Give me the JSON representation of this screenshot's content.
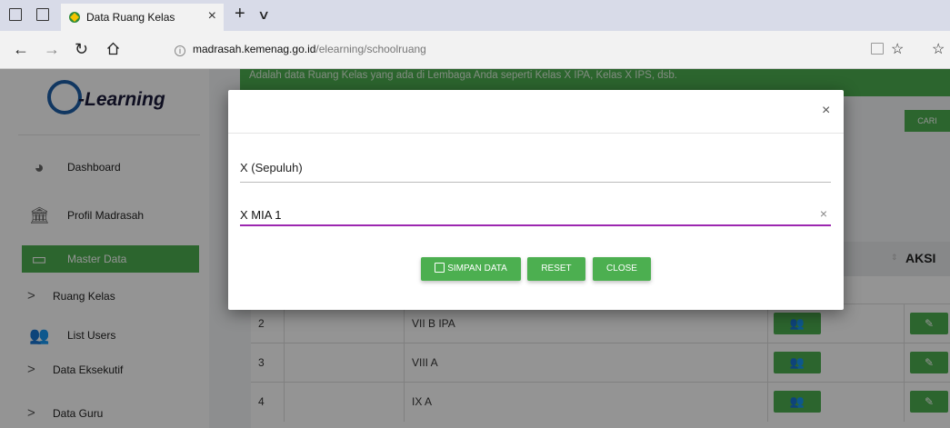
{
  "browser": {
    "tab_title": "Data Ruang Kelas",
    "tab_close": "×",
    "new_tab": "+",
    "tab_menu": "∨",
    "url_host": "madrasah.kemenag.go.id",
    "url_path": "/elearning/schoolruang"
  },
  "logo": {
    "text": "-Learning"
  },
  "sidebar": {
    "items": [
      {
        "label": "Dashboard",
        "icon": "dashboard-icon"
      },
      {
        "label": "Profil Madrasah",
        "icon": "institution-icon"
      },
      {
        "label": "Master Data",
        "icon": "monitor-icon"
      },
      {
        "label": "List Users",
        "icon": "users-icon"
      }
    ],
    "submenus": [
      "Ruang Kelas",
      "Data Eksekutif",
      "Data Guru"
    ],
    "arrow": ">"
  },
  "banner": {
    "text": "Adalah data Ruang Kelas yang ada di Lembaga Anda seperti Kelas X IPA, Kelas X IPS, dsb."
  },
  "search": {
    "button": "CARI"
  },
  "table": {
    "aksi_header": "AKSI",
    "rows": [
      {
        "no": "2",
        "name": "VII B IPA"
      },
      {
        "no": "3",
        "name": "VIII A"
      },
      {
        "no": "4",
        "name": "IX A"
      }
    ]
  },
  "modal": {
    "close": "×",
    "level_value": "X (Sepuluh)",
    "class_value": "X MIA 1",
    "clear": "×",
    "save_label": "SIMPAN DATA",
    "reset_label": "RESET",
    "close_label": "CLOSE"
  },
  "colors": {
    "accent": "#4caf50",
    "focus": "#9c27b0"
  }
}
